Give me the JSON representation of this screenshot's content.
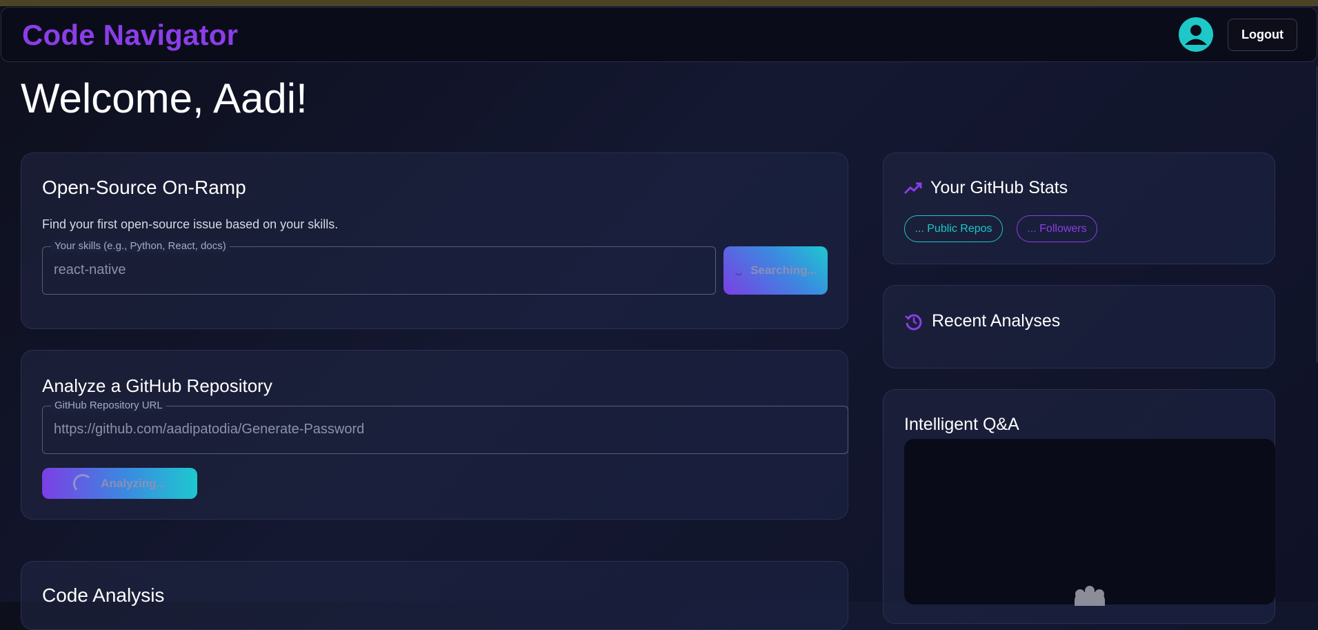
{
  "app": {
    "brand": "Code Navigator"
  },
  "header": {
    "logout_label": "Logout",
    "avatar_icon": "person-icon"
  },
  "welcome": {
    "title": "Welcome, Aadi!"
  },
  "onramp": {
    "title": "Open-Source On-Ramp",
    "description": "Find your first open-source issue based on your skills.",
    "skills_label": "Your skills (e.g., Python, React, docs)",
    "skills_value": "react-native",
    "search_button_label": "Searching..."
  },
  "analyze": {
    "title": "Analyze a GitHub Repository",
    "url_label": "GitHub Repository URL",
    "url_value": "https://github.com/aadipatodia/Generate-Password",
    "analyze_button_label": "Analyzing..."
  },
  "code_analysis": {
    "title": "Code Analysis"
  },
  "stats": {
    "title": "Your GitHub Stats",
    "icon": "trending-up-icon",
    "public_repos_label": "... Public Repos",
    "followers_label": "... Followers"
  },
  "recent": {
    "title": "Recent Analyses",
    "icon": "history-icon"
  },
  "qa": {
    "title": "Intelligent Q&A",
    "icon": "bot-icon"
  },
  "colors": {
    "brand": "#8a3ee8",
    "teal": "#1ec8c8",
    "purple": "#7b3fe4"
  }
}
